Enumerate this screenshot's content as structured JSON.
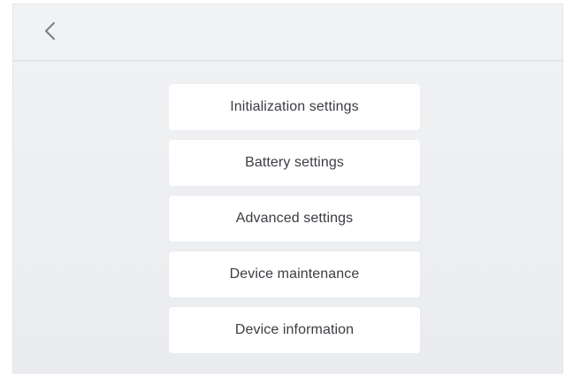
{
  "header": {
    "back_icon": "chevron-left-icon"
  },
  "menu": {
    "items": [
      {
        "label": "Initialization settings"
      },
      {
        "label": "Battery settings"
      },
      {
        "label": "Advanced settings"
      },
      {
        "label": "Device maintenance"
      },
      {
        "label": "Device information"
      }
    ]
  },
  "colors": {
    "background": "#eceef1",
    "item_background": "#ffffff",
    "text": "#3a3d42",
    "icon": "#7a7e84"
  }
}
